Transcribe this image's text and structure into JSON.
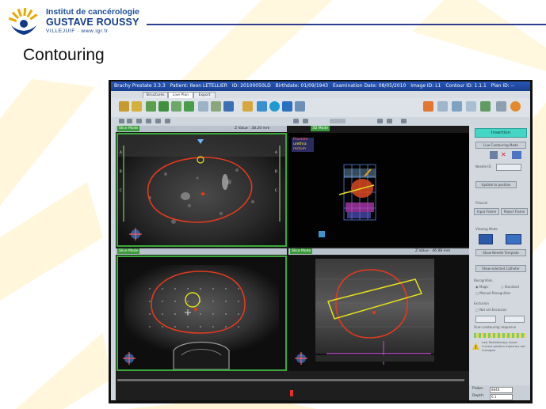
{
  "slide": {
    "title": "Contouring",
    "colors": {
      "brand": "#123a8c",
      "accent": "#e8a800",
      "rule": "#2d3e8e"
    }
  },
  "logo": {
    "line1": "Institut de cancérologie",
    "line2": "GUSTAVE ROUSSY",
    "line3": "VILLEJUIF · www.igr.fr",
    "icon": "sunburst-logo-icon"
  },
  "app": {
    "titlebar": {
      "app_name": "Brachy Prostate 3.3.3",
      "patient": "Patient: Ileon LETELLIER",
      "id": "ID: 20100050LD",
      "birthdate": "Birthdate: 01/09/1943",
      "exam_date": "Examination Date: 08/05/2010",
      "image_id": "Image ID: L1",
      "contour_id": "Contour ID: 1.1.1",
      "plan_id": "Plan ID: --"
    },
    "tabs": [
      "Structures",
      "Live Plan",
      "Export"
    ],
    "viewer": {
      "top_left_label": "Slice Mode",
      "top_left_value": "Z Value : 38.20 mm",
      "top_right_label": "3D Mode",
      "bottom_left_label": "Slice Mode",
      "bottom_right_label": "Slice Mode",
      "bottom_right_value": "Z Value : 46.98 mm",
      "legend": {
        "prostate": "Prostate",
        "urethra": "urethra",
        "rectum": "rectum"
      }
    },
    "right_panel": {
      "insertion_button": "Insertion",
      "contour_mode_button": "Live Contouring Mode",
      "needle_label": "Needle ID",
      "update_button": "Update to position",
      "fiducial_label": "Fiducial",
      "input_frame_button": "Input Frame",
      "reject_frame_button": "Reject Frame",
      "viewing_mode_label": "Viewing Mode",
      "show_template_button": "Show Needle Template",
      "show_catheter_button": "Show selected Catheter",
      "recognition_label": "Recognition",
      "magic_option": "Magic",
      "standard_option": "Standard",
      "manual_option": "Manual Recognition",
      "exclusion_label": "Exclusion",
      "not_exclusion_option": "Not set Exclusion",
      "scan_label": "Scan contouring sequence",
      "warning_text": "Last Radiotherapy report Current position trajectory not managed",
      "probe_label": "Probe:",
      "probe_value": "8848",
      "depth_label": "Depth:",
      "depth_value": "6.1"
    }
  }
}
